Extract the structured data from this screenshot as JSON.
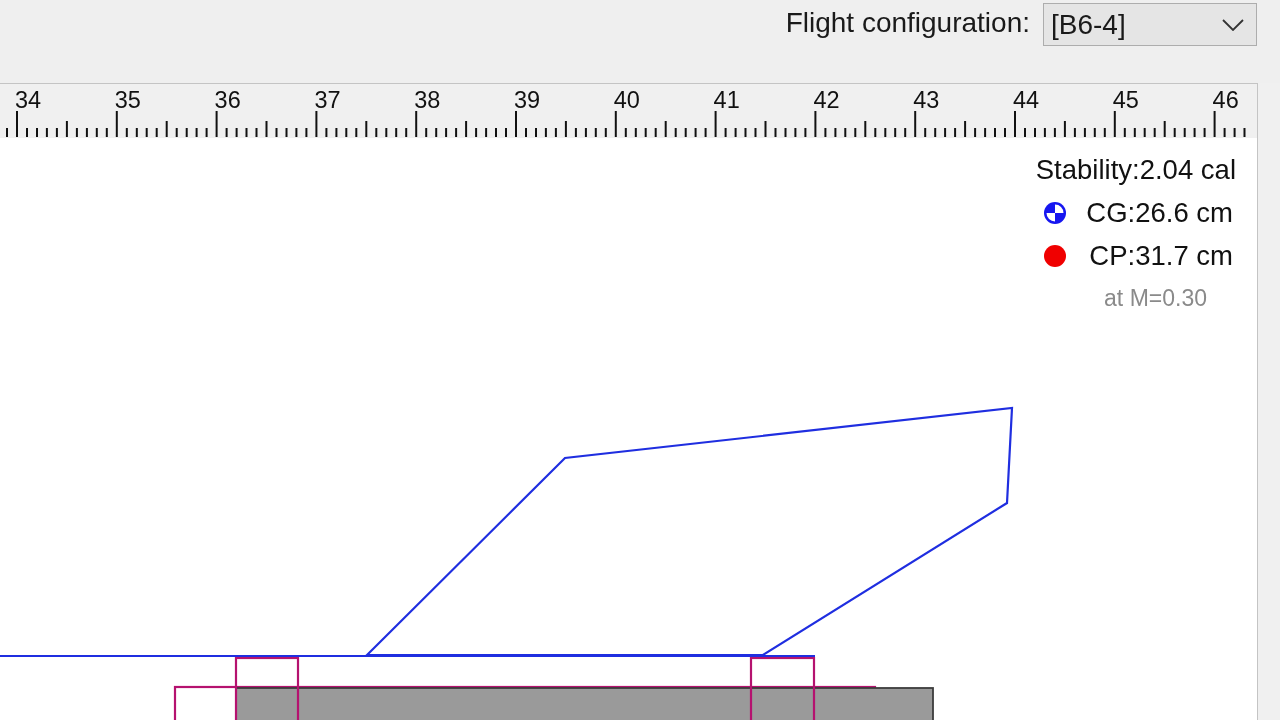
{
  "toolbar": {
    "label": "Flight configuration:",
    "dropdown": {
      "value": "[B6-4]"
    }
  },
  "ruler": {
    "labels": [
      "34",
      "35",
      "36",
      "37",
      "38",
      "39",
      "40",
      "41",
      "42",
      "43",
      "44",
      "45",
      "46"
    ]
  },
  "stability": {
    "title": "Stability:2.04 cal",
    "markers": [
      {
        "kind": "cg",
        "text": "CG:26.6 cm"
      },
      {
        "kind": "cp",
        "text": "CP:31.7 cm"
      }
    ],
    "note": "at M=0.30"
  }
}
